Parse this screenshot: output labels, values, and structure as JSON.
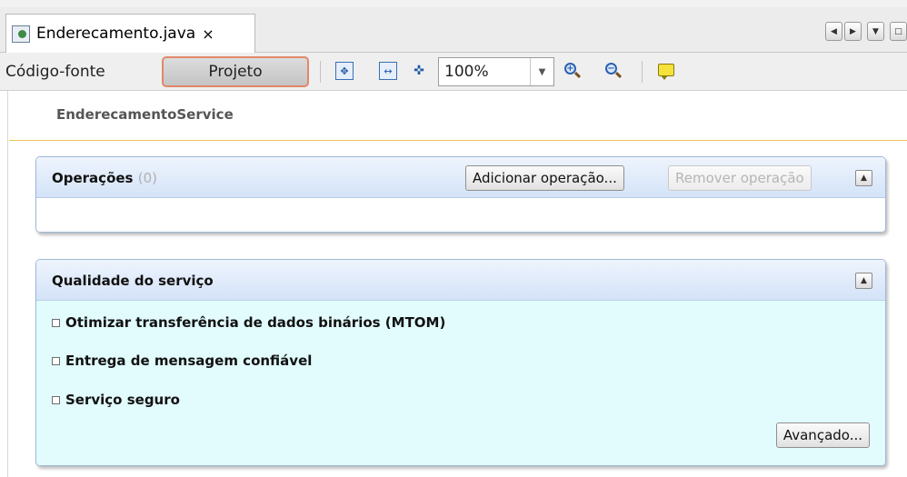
{
  "tab": {
    "title": "Enderecamento.java",
    "close_glyph": "×"
  },
  "toolbar": {
    "source_label": "Código-fonte",
    "project_label": "Projeto",
    "zoom_value": "100%"
  },
  "service": {
    "name": "EnderecamentoService"
  },
  "operations": {
    "title": "Operações",
    "count": "(0)",
    "add_label": "Adicionar operação...",
    "remove_label": "Remover operação"
  },
  "qos": {
    "title": "Qualidade do serviço",
    "options": [
      {
        "label": "Otimizar transferência de dados binários (MTOM)",
        "checked": false
      },
      {
        "label": "Entrega de mensagem confiável",
        "checked": false
      },
      {
        "label": "Serviço seguro",
        "checked": false
      }
    ],
    "advanced_label": "Avançado..."
  },
  "colors": {
    "accent_border": "#e0896a",
    "panel_header": "#d4e3f8",
    "qos_body": "#e2fbfd",
    "separator_gold": "#e8c35c"
  }
}
